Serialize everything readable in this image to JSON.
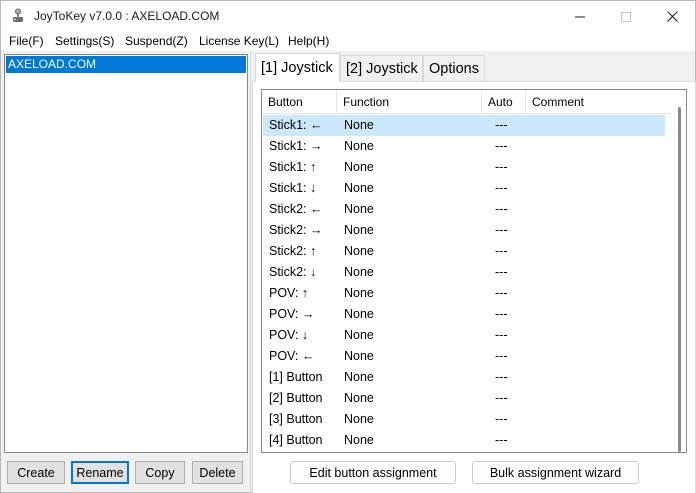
{
  "window": {
    "title": "JoyToKey v7.0.0 : AXELOAD.COM"
  },
  "menu": [
    {
      "label": "File(F)"
    },
    {
      "label": "Settings(S)"
    },
    {
      "label": "Suspend(Z)"
    },
    {
      "label": "License Key(L)"
    },
    {
      "label": "Help(H)"
    }
  ],
  "configs": {
    "items": [
      "AXELOAD.COM"
    ],
    "selected": "AXELOAD.COM"
  },
  "config_buttons": {
    "create": "Create",
    "rename": "Rename",
    "copy": "Copy",
    "delete": "Delete"
  },
  "tabs": [
    {
      "label": "[1] Joystick",
      "active": true
    },
    {
      "label": "[2] Joystick",
      "active": false
    },
    {
      "label": "Options",
      "active": false
    }
  ],
  "table": {
    "headers": {
      "button": "Button",
      "function": "Function",
      "auto": "Auto",
      "comment": "Comment"
    },
    "rows": [
      {
        "button": "Stick1: ←",
        "function": "None",
        "auto": "---",
        "comment": ""
      },
      {
        "button": "Stick1: →",
        "function": "None",
        "auto": "---",
        "comment": ""
      },
      {
        "button": "Stick1: ↑",
        "function": "None",
        "auto": "---",
        "comment": ""
      },
      {
        "button": "Stick1: ↓",
        "function": "None",
        "auto": "---",
        "comment": ""
      },
      {
        "button": "Stick2: ←",
        "function": "None",
        "auto": "---",
        "comment": ""
      },
      {
        "button": "Stick2: →",
        "function": "None",
        "auto": "---",
        "comment": ""
      },
      {
        "button": "Stick2: ↑",
        "function": "None",
        "auto": "---",
        "comment": ""
      },
      {
        "button": "Stick2: ↓",
        "function": "None",
        "auto": "---",
        "comment": ""
      },
      {
        "button": "POV: ↑",
        "function": "None",
        "auto": "---",
        "comment": ""
      },
      {
        "button": "POV: →",
        "function": "None",
        "auto": "---",
        "comment": ""
      },
      {
        "button": "POV: ↓",
        "function": "None",
        "auto": "---",
        "comment": ""
      },
      {
        "button": "POV: ←",
        "function": "None",
        "auto": "---",
        "comment": ""
      },
      {
        "button": "[1] Button",
        "function": "None",
        "auto": "---",
        "comment": ""
      },
      {
        "button": "[2] Button",
        "function": "None",
        "auto": "---",
        "comment": ""
      },
      {
        "button": "[3] Button",
        "function": "None",
        "auto": "---",
        "comment": ""
      },
      {
        "button": "[4] Button",
        "function": "None",
        "auto": "---",
        "comment": ""
      }
    ]
  },
  "actions": {
    "edit": "Edit button assignment",
    "bulk": "Bulk assignment wizard"
  },
  "colors": {
    "selection": "#0078d7",
    "row_highlight": "#cce8ff"
  }
}
